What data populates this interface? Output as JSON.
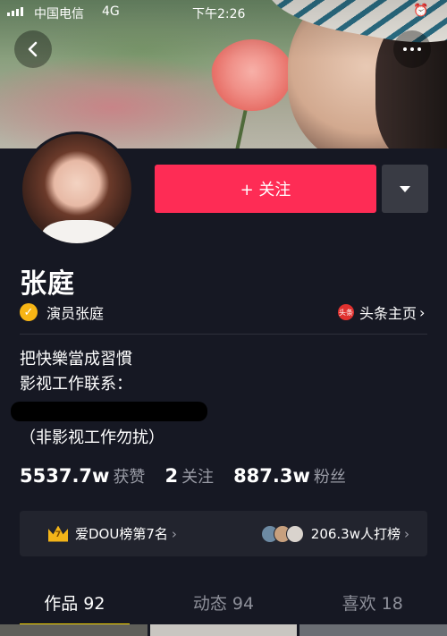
{
  "status_bar": {
    "carrier": "中国电信",
    "network": "4G",
    "time": "下午2:26",
    "alarm_icon": "alarm-icon"
  },
  "header": {
    "back_icon": "back-arrow-icon",
    "more_icon": "more-dots-icon"
  },
  "profile": {
    "follow_label": "+ 关注",
    "name": "张庭",
    "verified_label": "演员张庭",
    "toutiao_label": "头条主页",
    "toutiao_badge": "头条",
    "bio": {
      "line1": "把快樂當成習慣",
      "line2": "影视工作联系：",
      "line3": "（非影视工作勿扰）"
    },
    "stats": [
      {
        "value": "5537.7w",
        "label": "获赞"
      },
      {
        "value": "2",
        "label": "关注"
      },
      {
        "value": "887.3w",
        "label": "粉丝"
      }
    ]
  },
  "rank": {
    "badge_text": "7",
    "left_label": "爱DOU榜第7名",
    "right_label": "206.3w人打榜"
  },
  "tabs": [
    {
      "label": "作品 92",
      "active": true
    },
    {
      "label": "动态 94",
      "active": false
    },
    {
      "label": "喜欢 18",
      "active": false
    }
  ],
  "colors": {
    "background": "#161823",
    "follow_button": "#fe2c55",
    "tab_indicator": "#fdd900",
    "verified_badge": "#f7b515"
  }
}
